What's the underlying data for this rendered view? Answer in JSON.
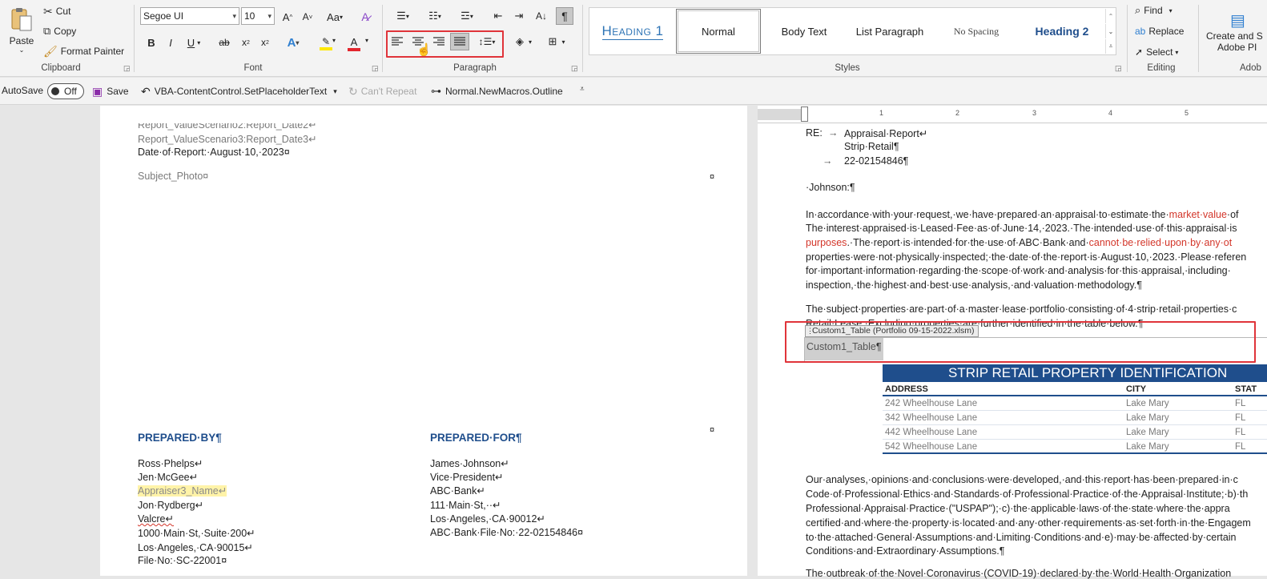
{
  "ribbon": {
    "clipboard": {
      "paste": "Paste",
      "cut": "Cut",
      "copy": "Copy",
      "format_painter": "Format Painter",
      "group": "Clipboard"
    },
    "font": {
      "name": "Segoe UI",
      "size": "10",
      "group": "Font"
    },
    "paragraph": {
      "group": "Paragraph"
    },
    "styles": {
      "items": [
        "Heading 1",
        "Normal",
        "Body Text",
        "List Paragraph",
        "No Spacing",
        "Heading 2"
      ],
      "group": "Styles"
    },
    "editing": {
      "find": "Find",
      "replace": "Replace",
      "select": "Select",
      "group": "Editing"
    },
    "adobe": {
      "create_line1": "Create and S",
      "create_line2": "Adobe PI",
      "group": "Adob"
    }
  },
  "qat": {
    "autosave": "AutoSave",
    "autosave_state": "Off",
    "save": "Save",
    "macro1": "VBA-ContentControl.SetPlaceholderText",
    "cant_repeat": "Can't Repeat",
    "macro2": "Normal.NewMacros.Outline"
  },
  "ruler": {
    "numbers": [
      "1",
      "2",
      "3",
      "4",
      "5"
    ]
  },
  "left_page": {
    "lines_top": [
      "Report_ValueScenario2:Report_Date2↵",
      "Report_ValueScenario3:Report_Date3↵",
      "Date·of·Report:·August·10,·2023¤"
    ],
    "subject_photo": "Subject_Photo¤",
    "cell_mark": "¤",
    "prepared_by": {
      "title": "PREPARED·BY¶",
      "lines": [
        "Ross·Phelps↵",
        "Jen·McGee↵",
        "Appraiser3_Name↵",
        "Jon·Rydberg↵",
        "Valcre↵",
        "1000·Main·St,·Suite·200↵",
        "Los·Angeles,·CA·90015↵",
        "File·No:·SC-22001¤"
      ]
    },
    "prepared_for": {
      "title": "PREPARED·FOR¶",
      "lines": [
        "James·Johnson↵",
        "Vice·President↵",
        "ABC·Bank↵",
        "111·Main·St,··↵",
        "Los·Angeles,·CA·90012↵",
        "ABC·Bank·File·No:·22-02154846¤"
      ]
    }
  },
  "right_page": {
    "re_label": "RE:",
    "arrow": "→",
    "re_lines": [
      "Appraisal·Report↵",
      "Strip·Retail¶",
      "22-02154846¶"
    ],
    "salutation": "·Johnson:¶",
    "p1": {
      "l1a": "In·accordance·with·your·request,·we·have·prepared·an·appraisal·to·estimate·the·",
      "l1b": "market·value",
      "l1c": "·of",
      "l2": "The·interest·appraised·is·Leased·Fee·as·of·June·14,·2023.·The·intended·use·of·this·appraisal·is",
      "l3a": "purposes",
      "l3b": ".·The·report·is·intended·for·the·use·of·ABC·Bank·and·",
      "l3c": "cannot·be·relied·upon·by·any·ot",
      "l4": "properties·were·not·physically·inspected;·the·date·of·the·report·is·August·10,·2023.·Please·referen",
      "l5": "for·important·information·regarding·the·scope·of·work·and·analysis·for·this·appraisal,·including·",
      "l6": "inspection,·the·highest·and·best·use·analysis,·and·valuation·methodology.¶"
    },
    "p2": {
      "l1": "The·subject·properties·are·part·of·a·master·lease·portfolio·consisting·of·4·strip·retail·properties·c",
      "l2": "Retail·Lease,·Excluding·properties·are·further·identified·in·the·table·below.¶"
    },
    "cc_tag": "Custom1_Table (Portfolio 09-15-2022.xlsm)",
    "cc_placeholder": "Custom1_Table",
    "cc_mark": "¶",
    "table": {
      "title": "STRIP RETAIL PROPERTY IDENTIFICATION",
      "headers": [
        "ADDRESS",
        "CITY",
        "STAT"
      ],
      "rows": [
        [
          "242 Wheelhouse Lane",
          "Lake Mary",
          "FL"
        ],
        [
          "342 Wheelhouse Lane",
          "Lake Mary",
          "FL"
        ],
        [
          "442 Wheelhouse Lane",
          "Lake Mary",
          "FL"
        ],
        [
          "542 Wheelhouse Lane",
          "Lake Mary",
          "FL"
        ]
      ]
    },
    "p3": [
      "Our·analyses,·opinions·and·conclusions·were·developed,·and·this·report·has·been·prepared·in·c",
      "Code·of·Professional·Ethics·and·Standards·of·Professional·Practice·of·the·Appraisal·Institute;·b)·th",
      "Professional·Appraisal·Practice·(\"USPAP\");·c)·the·applicable·laws·of·the·state·where·the·appra",
      "certified·and·where·the·property·is·located·and·any·other·requirements·as·set·forth·in·the·Engagem",
      "to·the·attached·General·Assumptions·and·Limiting·Conditions·and·e)·may·be·affected·by·certain",
      "Conditions·and·Extraordinary·Assumptions.¶"
    ],
    "p4": "The·outbreak·of·the·Novel·Coronavirus·(COVID-19)·declared·by·the·World·Health·Organization"
  },
  "colors": {
    "accent_red": "#e0343a",
    "heading_blue": "#1f4e8c",
    "table_header": "#1f4e8c"
  }
}
